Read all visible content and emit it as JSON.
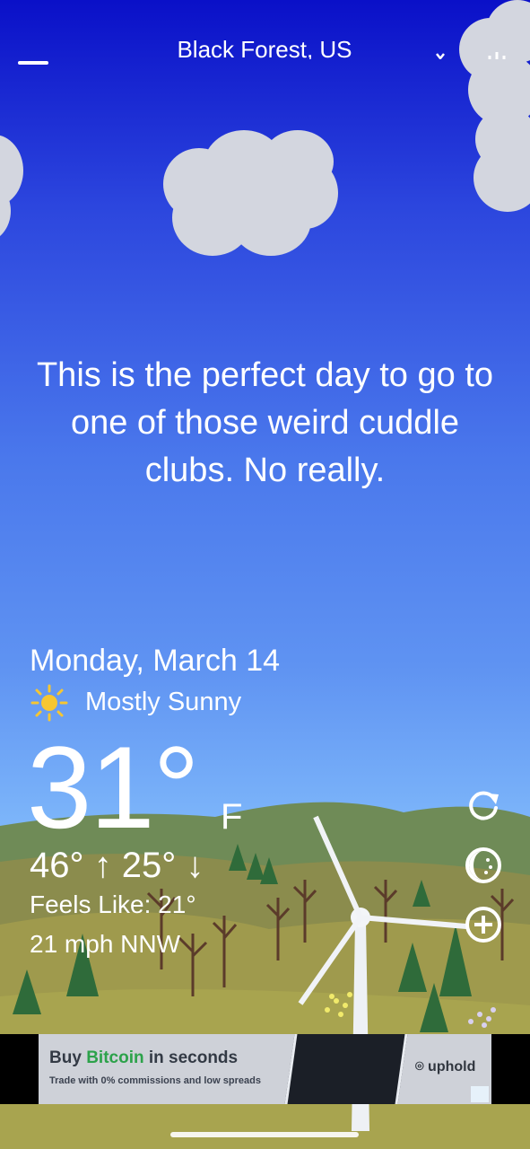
{
  "header": {
    "location": "Black Forest, US",
    "menu_icon": "hamburger-menu-icon",
    "dropdown_icon": "chevron-down-icon",
    "share_icon": "share-icon"
  },
  "quote": "This is the perfect day to go to one of those weird cuddle clubs. No really.",
  "weather": {
    "date": "Monday, March 14",
    "condition_icon": "sun-icon",
    "condition": "Mostly Sunny",
    "temperature": "31°",
    "unit": "F",
    "hi_lo": "46° ↑ 25° ↓",
    "feels_like": "Feels Like: 21°",
    "wind": "21 mph NNW"
  },
  "side_buttons": {
    "refresh_icon": "refresh-icon",
    "moon_icon": "moon-phase-icon",
    "add_icon": "add-circle-icon"
  },
  "ad": {
    "title_pre": "Buy ",
    "title_highlight": "Bitcoin",
    "title_post": " in seconds",
    "subtitle": "Trade with 0% commissions and low spreads",
    "brand": "uphold",
    "brand_color": "#2ca24a"
  }
}
